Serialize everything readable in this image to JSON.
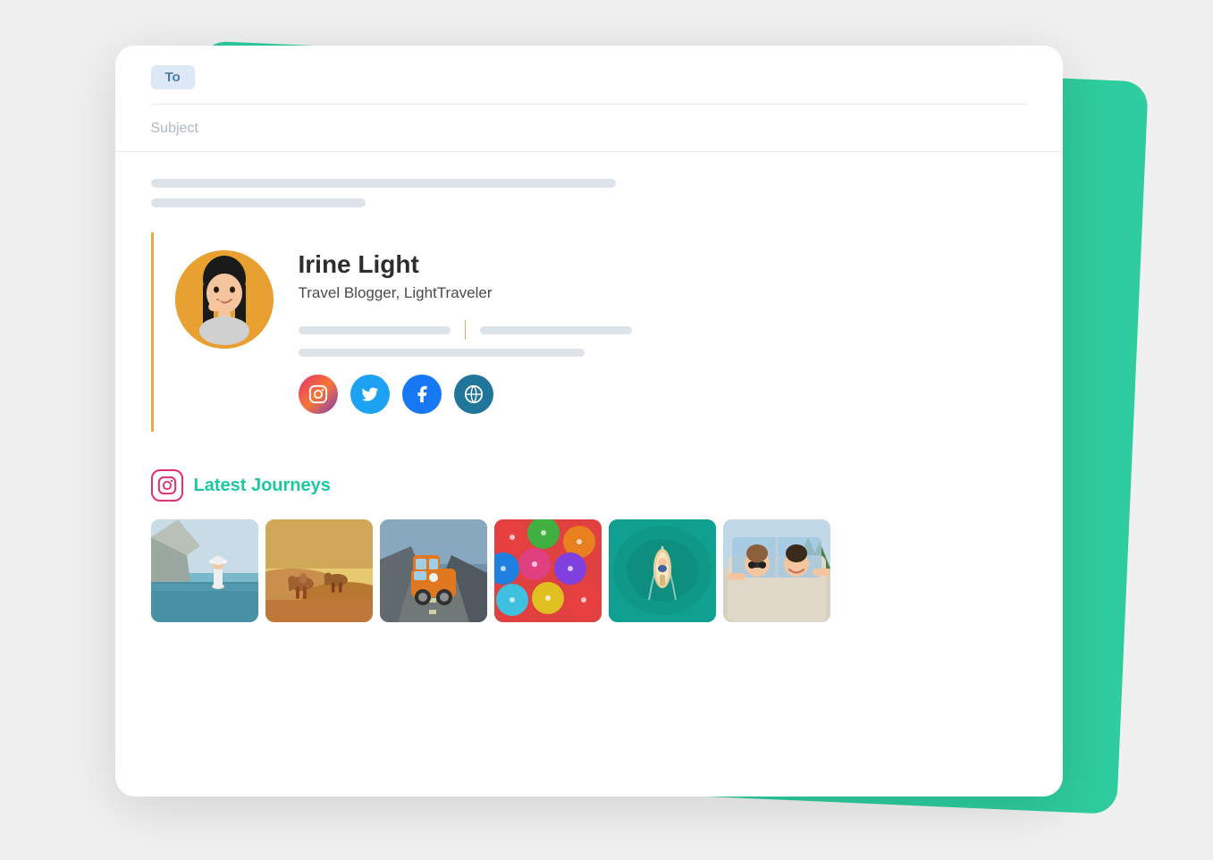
{
  "header": {
    "to_label": "To",
    "subject_placeholder": "Subject"
  },
  "signature": {
    "name": "Irine Light",
    "title": "Travel Blogger, LightTraveler"
  },
  "social": {
    "instagram_label": "Instagram",
    "twitter_label": "Twitter",
    "facebook_label": "Facebook",
    "wordpress_label": "WordPress"
  },
  "latest_journeys": {
    "section_title": "Latest Journeys",
    "icon_label": "instagram-icon"
  },
  "photos": [
    {
      "id": 1,
      "alt": "Coastal view with person in hat"
    },
    {
      "id": 2,
      "alt": "Camels in desert"
    },
    {
      "id": 3,
      "alt": "Orange van on rocky road"
    },
    {
      "id": 4,
      "alt": "Colorful umbrellas"
    },
    {
      "id": 5,
      "alt": "Aerial boat view"
    },
    {
      "id": 6,
      "alt": "People in car"
    }
  ],
  "colors": {
    "accent_teal": "#2ecc9e",
    "accent_orange": "#e8a84e",
    "to_badge_bg": "#dce8f5",
    "to_badge_text": "#4a7ab0"
  }
}
